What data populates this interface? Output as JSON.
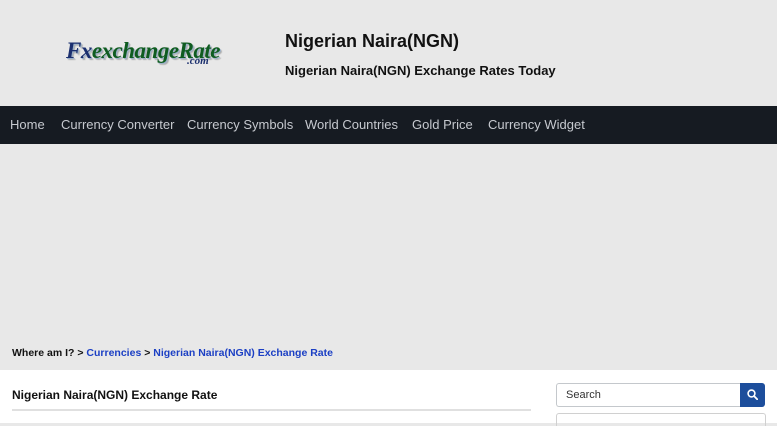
{
  "site": {
    "logo_main_fx": "Fx",
    "logo_main_rest": "exchangeRate",
    "logo_suffix": ".com",
    "title": "Nigerian Naira(NGN)",
    "subtitle": "Nigerian Naira(NGN) Exchange Rates Today"
  },
  "nav": {
    "items": [
      {
        "label": "Home"
      },
      {
        "label": "Currency Converter"
      },
      {
        "label": "Currency Symbols"
      },
      {
        "label": "World Countries"
      },
      {
        "label": "Gold Price"
      },
      {
        "label": "Currency Widget"
      }
    ]
  },
  "breadcrumb": {
    "prefix": "Where am I?",
    "sep1": ">",
    "link1": "Currencies",
    "sep2": ">",
    "link2": "Nigerian Naira(NGN) Exchange Rate"
  },
  "main": {
    "section_title": "Nigerian Naira(NGN) Exchange Rate"
  },
  "search": {
    "placeholder": "Search",
    "icon": "search-icon"
  },
  "colors": {
    "nav_bg": "#161b22",
    "link": "#1b3fc4",
    "search_button": "#1d4e9c",
    "logo_green": "#0f5c20",
    "logo_blue": "#1b2f6e"
  }
}
